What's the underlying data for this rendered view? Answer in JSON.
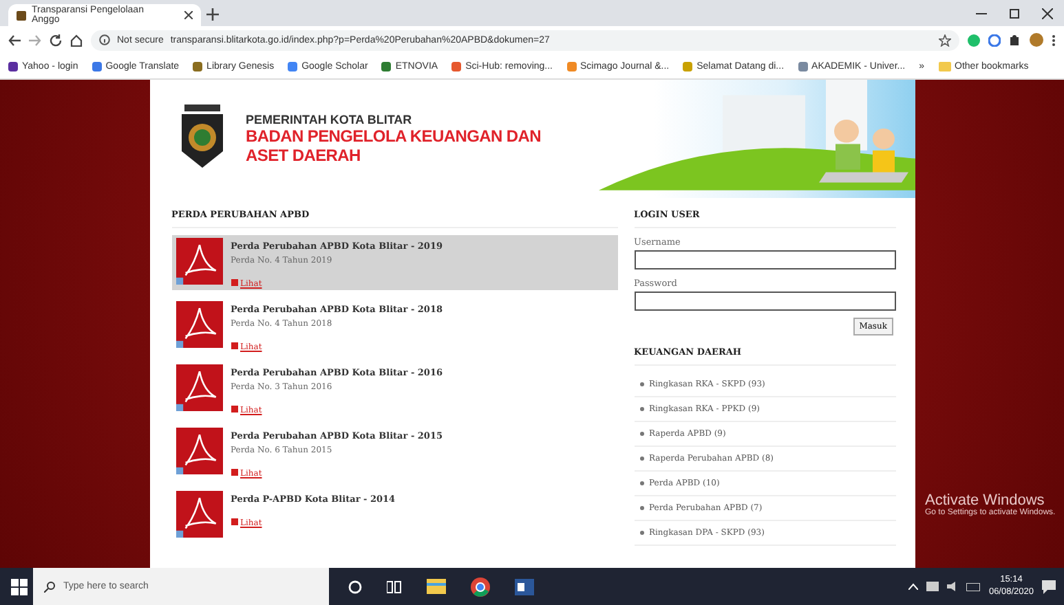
{
  "browser": {
    "tabs": [
      {
        "title": "Transparansi Pengelolaan Anggo",
        "selected": true
      }
    ],
    "address": {
      "security": "Not secure",
      "url": "transparansi.blitarkota.go.id/index.php?p=Perda%20Perubahan%20APBD&dokumen=27"
    },
    "bookmarks": [
      {
        "label": "Yahoo - login",
        "color": "#5b2fa0"
      },
      {
        "label": "Google Translate",
        "color": "#3b78e7"
      },
      {
        "label": "Library Genesis",
        "color": "#8a6d1f"
      },
      {
        "label": "Google Scholar",
        "color": "#4285f4"
      },
      {
        "label": "ETNOVIA",
        "color": "#2e7d32"
      },
      {
        "label": "Sci-Hub: removing...",
        "color": "#e6582e"
      },
      {
        "label": "Scimago Journal &...",
        "color": "#f08a24"
      },
      {
        "label": "Selamat Datang di...",
        "color": "#c9a100"
      },
      {
        "label": "AKADEMIK - Univer...",
        "color": "#7a8aa0"
      }
    ],
    "more_bookmarks": "»",
    "other_bookmarks": "Other bookmarks"
  },
  "header": {
    "subtitle": "PEMERINTAH KOTA BLITAR",
    "title": "BADAN PENGELOLA KEUANGAN DAN ASET DAERAH"
  },
  "documents": {
    "heading": "PERDA PERUBAHAN APBD",
    "items": [
      {
        "title": "Perda Perubahan APBD Kota Blitar - 2019",
        "number": "Perda No. 4 Tahun 2019",
        "link": "Lihat",
        "selected": true
      },
      {
        "title": "Perda Perubahan APBD Kota Blitar - 2018",
        "number": "Perda No. 4 Tahun 2018",
        "link": "Lihat",
        "selected": false
      },
      {
        "title": "Perda Perubahan APBD Kota Blitar - 2016",
        "number": "Perda No. 3 Tahun 2016",
        "link": "Lihat",
        "selected": false
      },
      {
        "title": "Perda Perubahan APBD Kota Blitar - 2015",
        "number": "Perda No. 6 Tahun 2015",
        "link": "Lihat",
        "selected": false
      },
      {
        "title": "Perda P-APBD Kota Blitar - 2014",
        "link": "Lihat",
        "selected": false
      }
    ]
  },
  "login": {
    "heading": "LOGIN USER",
    "username_label": "Username",
    "password_label": "Password",
    "submit": "Masuk"
  },
  "finance": {
    "heading": "KEUANGAN DAERAH",
    "items": [
      "Ringkasan RKA - SKPD (93)",
      "Ringkasan RKA - PPKD (9)",
      "Raperda APBD (9)",
      "Raperda Perubahan APBD (8)",
      "Perda APBD (10)",
      "Perda Perubahan APBD (7)",
      "Ringkasan DPA - SKPD (93)"
    ]
  },
  "os_notice": {
    "title": "Activate Windows",
    "text": "Go to Settings to activate Windows."
  },
  "taskbar": {
    "search_placeholder": "Type here to search",
    "time": "15:14",
    "date": "06/08/2020"
  }
}
